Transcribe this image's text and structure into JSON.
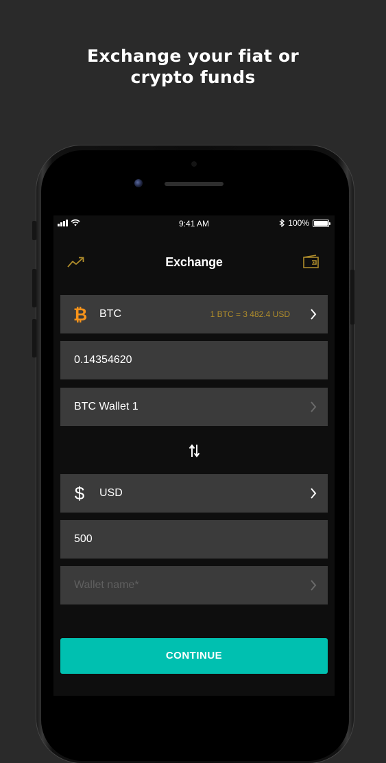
{
  "headline": {
    "line1": "Exchange your fiat or",
    "line2": "crypto funds"
  },
  "status_bar": {
    "time": "9:41 AM",
    "battery": "100%"
  },
  "nav": {
    "title": "Exchange",
    "left_icon": "chart-trend-icon",
    "right_icon": "wallet-icon"
  },
  "from": {
    "currency": "BTC",
    "currency_icon": "bitcoin-icon",
    "rate": "1 BTC = 3 482.4 USD",
    "amount": "0.14354620",
    "wallet": "BTC Wallet 1"
  },
  "swap_icon": "swap-arrows-icon",
  "to": {
    "currency": "USD",
    "currency_icon": "dollar-icon",
    "amount": "500",
    "wallet_placeholder": "Wallet name*"
  },
  "continue_label": "CONTINUE",
  "colors": {
    "page_background": "#2a2a2a",
    "screen_background": "#0e0e0e",
    "field_background": "#3b3b3b",
    "accent_gold": "#b08d2b",
    "bitcoin_orange": "#f7931a",
    "button_teal": "#00c0b0"
  }
}
